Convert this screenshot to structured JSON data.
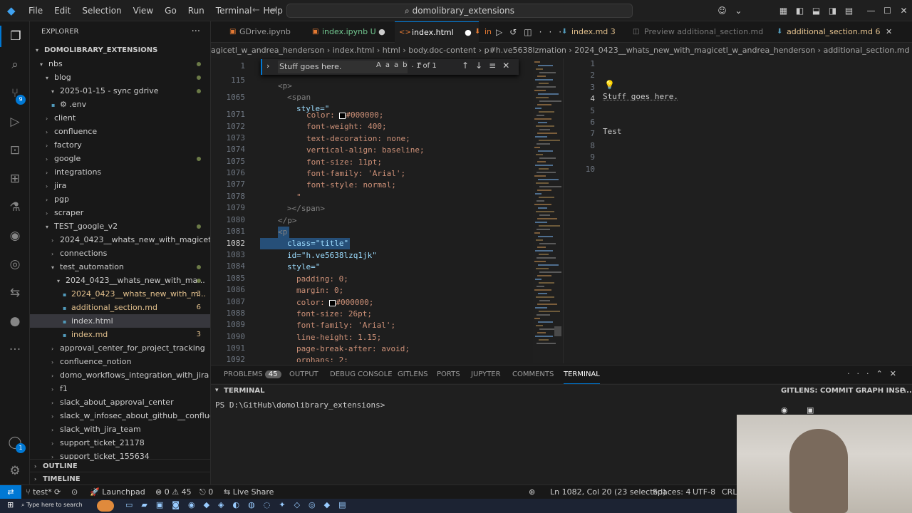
{
  "titlebar": {
    "menus": [
      "File",
      "Edit",
      "Selection",
      "View",
      "Go",
      "Run",
      "Terminal",
      "Help"
    ],
    "search": "domolibrary_extensions"
  },
  "activity": {
    "badge_scm": "9",
    "badge_acct": "1"
  },
  "explorer": {
    "title": "EXPLORER",
    "root": "DOMOLIBRARY_EXTENSIONS",
    "rows": [
      {
        "indent": 1,
        "chev": "▾",
        "label": "nbs",
        "dot": true
      },
      {
        "indent": 2,
        "chev": "▾",
        "label": "blog",
        "dot": true
      },
      {
        "indent": 3,
        "chev": "▾",
        "label": "2025-01-15 - sync gdrive",
        "dot": true
      },
      {
        "indent": 3,
        "chev": "",
        "label": "⚙ .env"
      },
      {
        "indent": 2,
        "chev": "›",
        "label": "client"
      },
      {
        "indent": 2,
        "chev": "›",
        "label": "confluence"
      },
      {
        "indent": 2,
        "chev": "›",
        "label": "factory"
      },
      {
        "indent": 2,
        "chev": "›",
        "label": "google",
        "dot": true
      },
      {
        "indent": 2,
        "chev": "›",
        "label": "integrations"
      },
      {
        "indent": 2,
        "chev": "›",
        "label": "jira"
      },
      {
        "indent": 2,
        "chev": "›",
        "label": "pgp"
      },
      {
        "indent": 2,
        "chev": "›",
        "label": "scraper"
      },
      {
        "indent": 2,
        "chev": "▾",
        "label": "TEST_google_v2",
        "dot": true
      },
      {
        "indent": 3,
        "chev": "›",
        "label": "2024_0423__whats_new_with_magicetl_w..."
      },
      {
        "indent": 3,
        "chev": "›",
        "label": "connections"
      },
      {
        "indent": 3,
        "chev": "▾",
        "label": "test_automation",
        "dot": true
      },
      {
        "indent": 4,
        "chev": "▾",
        "label": "2024_0423__whats_new_with_ma...",
        "dot": true
      },
      {
        "indent": 5,
        "chev": "",
        "label": "2024_0423__whats_new_with_m...",
        "count": "3"
      },
      {
        "indent": 5,
        "chev": "",
        "label": "additional_section.md",
        "count": "6"
      },
      {
        "indent": 5,
        "chev": "",
        "label": "index.html",
        "sel": true
      },
      {
        "indent": 5,
        "chev": "",
        "label": "index.md",
        "count": "3"
      },
      {
        "indent": 3,
        "chev": "›",
        "label": "approval_center_for_project_tracking"
      },
      {
        "indent": 3,
        "chev": "›",
        "label": "confluence_notion"
      },
      {
        "indent": 3,
        "chev": "›",
        "label": "domo_workflows_integration_with_jira"
      },
      {
        "indent": 3,
        "chev": "›",
        "label": "f1"
      },
      {
        "indent": 3,
        "chev": "›",
        "label": "slack_about_approval_center"
      },
      {
        "indent": 3,
        "chev": "›",
        "label": "slack_w_infosec_about_github__conflue..."
      },
      {
        "indent": 3,
        "chev": "›",
        "label": "slack_with_jira_team"
      },
      {
        "indent": 3,
        "chev": "›",
        "label": "support_ticket_21178"
      },
      {
        "indent": 3,
        "chev": "›",
        "label": "support_ticket_155634"
      }
    ],
    "outline": "OUTLINE",
    "timeline": "TIMELINE"
  },
  "tabs": [
    "GDrive.ipynb",
    "index.ipynb U",
    "index.html",
    "in",
    "index.md 3",
    "Preview additional_section.md",
    "additional_section.md 6"
  ],
  "breadcrumb": "agicetl_w_andrea_henderson  ›  index.html  ›  html  ›  body.doc-content  ›  p#h.ve5638lzmation  ›  2024_0423__whats_new_with_magicetl_w_andrea_henderson  ›  additional_section.md",
  "find": {
    "query": "Stuff goes here.",
    "result": "1 of 1"
  },
  "code": {
    "lines": [
      "1",
      "115",
      "1065",
      "1071",
      "1072",
      "1073",
      "1074",
      "1075",
      "1076",
      "1077",
      "1078",
      "1079",
      "1080",
      "1081",
      "1082",
      "1083",
      "1084",
      "1085",
      "1086",
      "1087",
      "1088",
      "1089",
      "1090",
      "1091",
      "1092"
    ],
    "current": "1082"
  },
  "code_text": {
    "l1065": "<p>",
    "l1065b": "<span",
    "l1071": "style=\"",
    "l1072a": "color: ",
    "l1072b": "#000000;",
    "l1073": "font-weight: 400;",
    "l1074": "text-decoration: none;",
    "l1075": "vertical-align: baseline;",
    "l1076": "font-size: 11pt;",
    "l1077": "font-family: 'Arial';",
    "l1078": "font-style: normal;",
    "l1079": "\"",
    "l1080": "></span>",
    "l1081": "</p>",
    "l1082": "<p",
    "l1083": "class=\"title\"",
    "l1084": "id=\"h.ve5638lzq1jk\"",
    "l1085": "style=\"",
    "l1086": "padding: 0;",
    "l1087": "margin: 0;",
    "l1088a": "color: ",
    "l1088b": "#000000;",
    "l1089": "font-size: 26pt;",
    "l1090": "font-family: 'Arial';",
    "l1091": "line-height: 1.15;",
    "l1092": "page-break-after: avoid;",
    "l1093": "orphans: 2;"
  },
  "preview": {
    "lines": [
      "1",
      "2",
      "3",
      "4",
      "5",
      "6",
      "7",
      "8",
      "9",
      "10"
    ],
    "text4": "Stuff goes here.",
    "text7": "Test"
  },
  "panel": {
    "tabs": [
      "PROBLEMS",
      "OUTPUT",
      "DEBUG CONSOLE",
      "GITLENS",
      "PORTS",
      "JUPYTER",
      "COMMENTS",
      "TERMINAL"
    ],
    "problems_count": "45",
    "terminal_title": "TERMINAL",
    "gitlens_label": "GITLENS: COMMIT GRAPH INSP...",
    "prompt": "PS D:\\GitHub\\domolibrary_extensions>"
  },
  "status": {
    "branch": "test*",
    "launch": "Launchpad",
    "errors": "0",
    "warnings": "45",
    "ports": "0",
    "liveshare": "Live Share",
    "cursor": "Ln 1082, Col 20 (23 selected)",
    "spaces": "Spaces: 4",
    "encoding": "UTF-8",
    "eol": "CRLF"
  },
  "taskbar": {
    "search": "Type here to search"
  }
}
